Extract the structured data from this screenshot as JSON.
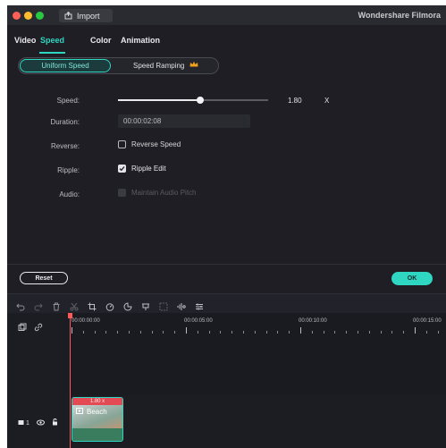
{
  "window": {
    "title": "Wondershare Filmora",
    "import_label": "Import"
  },
  "tabs": [
    {
      "label": "Video",
      "active": false
    },
    {
      "label": "Speed",
      "active": true
    },
    {
      "label": "Color",
      "active": false
    },
    {
      "label": "Animation",
      "active": false
    }
  ],
  "speed_mode": {
    "uniform_label": "Uniform Speed",
    "ramping_label": "Speed Ramping",
    "selected": "Uniform Speed"
  },
  "settings": {
    "speed_label": "Speed:",
    "speed_value": "1.80",
    "speed_unit": "X",
    "speed_slider_fraction": 0.55,
    "duration_label": "Duration:",
    "duration_value": "00:00:02:08",
    "reverse_label": "Reverse:",
    "reverse_option": "Reverse Speed",
    "reverse_checked": false,
    "ripple_label": "Ripple:",
    "ripple_option": "Ripple Edit",
    "ripple_checked": true,
    "audio_label": "Audio:",
    "audio_option": "Maintain Audio Pitch",
    "audio_enabled": false
  },
  "actions": {
    "reset_label": "Reset",
    "ok_label": "OK"
  },
  "toolbar_icons": [
    "undo-icon",
    "redo-icon",
    "delete-icon",
    "cut-icon",
    "crop-icon",
    "speed-icon",
    "color-icon",
    "split-icon",
    "fullscreen-icon",
    "voice-icon",
    "adjust-icon"
  ],
  "timeline": {
    "ruler_labels": [
      "00:00:00:00",
      "00:00:05:00",
      "00:00:10:00",
      "00:00:15:00"
    ],
    "track_label": "1",
    "clip": {
      "name": "Beach",
      "speed_badge": "1.80 x"
    }
  },
  "colors": {
    "accent": "#2fd6c2",
    "playhead": "#ff5a5a",
    "background": "#1e1e24"
  }
}
